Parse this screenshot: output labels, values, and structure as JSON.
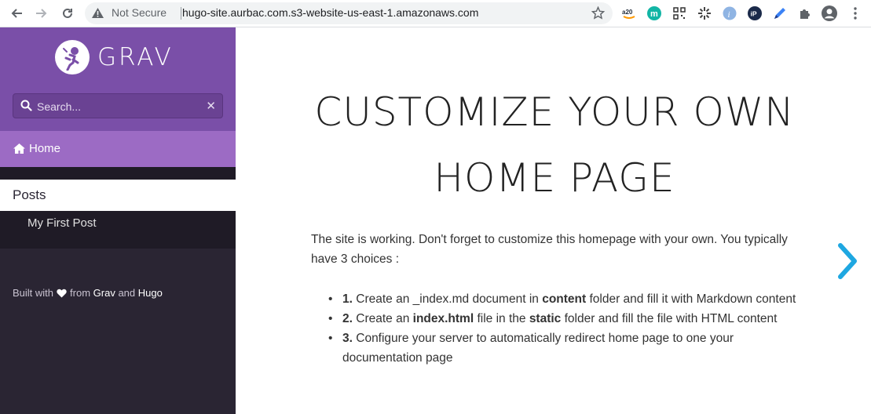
{
  "browser": {
    "security_label": "Not Secure",
    "url": "hugo-site.aurbac.com.s3-website-us-east-1.amazonaws.com",
    "extensions": [
      "amazon-extension-icon",
      "m-extension-icon",
      "qr-code-extension-icon",
      "sparkle-extension-icon",
      "info-extension-icon",
      "ip-extension-icon",
      "pen-extension-icon",
      "puzzle-extensions-icon"
    ]
  },
  "sidebar": {
    "logo_text": "GRAV",
    "search_placeholder": "Search...",
    "home_label": "Home",
    "section_title": "Posts",
    "posts": [
      "My First Post"
    ],
    "footer": {
      "built_with": "Built with",
      "from": "from",
      "grav": "Grav",
      "and": "and",
      "hugo": "Hugo"
    }
  },
  "main": {
    "title_line1": "CUSTOMIZE YOUR OWN",
    "title_line2": "HOME PAGE",
    "intro": "The site is working. Don't forget to customize this homepage with your own. You typically have 3 choices :",
    "choices": [
      {
        "num": "1.",
        "a": "Create an _index.md document in ",
        "bold": "content",
        "b": " folder and fill it with Markdown content"
      },
      {
        "num": "2.",
        "a": "Create an ",
        "bold": "index.html",
        "b": " file in the ",
        "bold2": "static",
        "c": " folder and fill the file with HTML content"
      },
      {
        "num": "3.",
        "a": "Configure your server to automatically redirect home page to one your documentation page"
      }
    ]
  },
  "colors": {
    "sidebar_header": "#7a4fa8",
    "home_active": "#9c6bc4",
    "sidebar_dark": "#2a2533",
    "next_arrow": "#1ea7e1"
  }
}
